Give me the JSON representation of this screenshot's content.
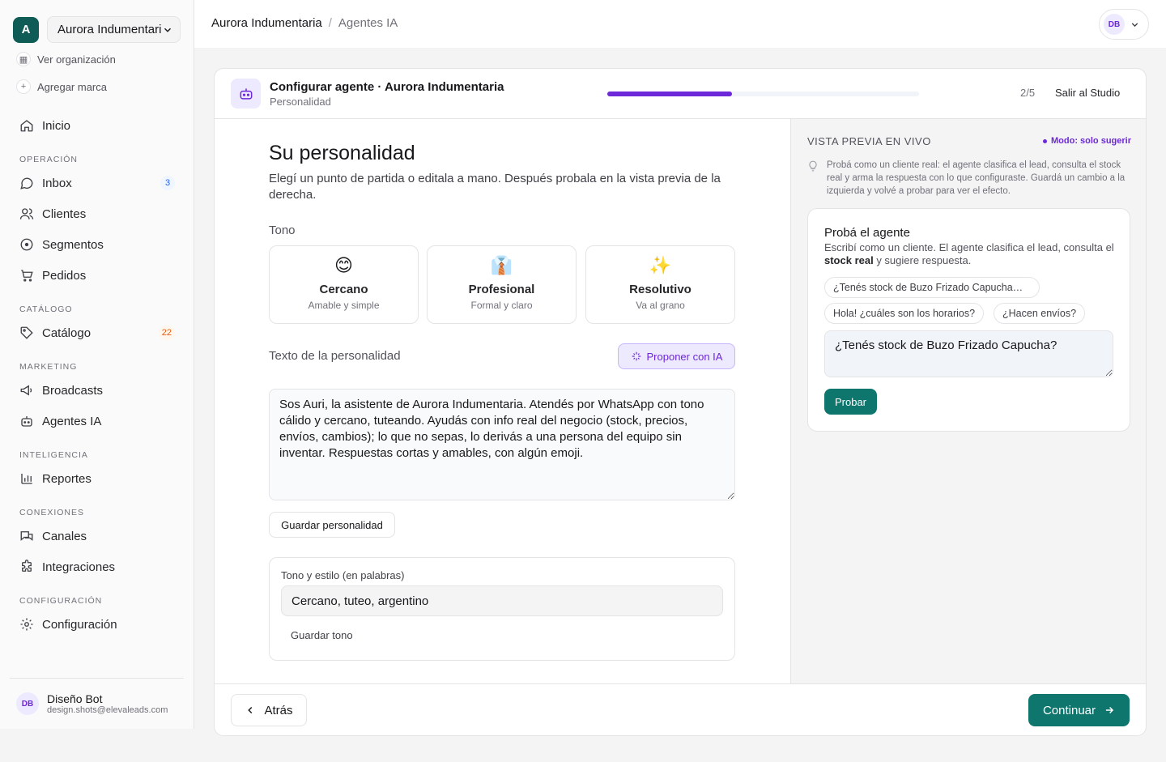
{
  "org": {
    "initial": "A",
    "selected": "Aurora Indumentaria",
    "view_org": "Ver organización",
    "add_brand": "Agregar marca"
  },
  "sidebar": {
    "home": "Inicio",
    "sections": {
      "operacion": "OPERACIÓN",
      "catalogo": "CATÁLOGO",
      "marketing": "MARKETING",
      "inteligencia": "INTELIGENCIA",
      "conexiones": "CONEXIONES",
      "configuracion": "CONFIGURACIÓN"
    },
    "items": {
      "inbox": "Inbox",
      "inbox_count": "3",
      "clientes": "Clientes",
      "segmentos": "Segmentos",
      "pedidos": "Pedidos",
      "catalogo": "Catálogo",
      "catalogo_count": "22",
      "broadcasts": "Broadcasts",
      "agentes": "Agentes IA",
      "reportes": "Reportes",
      "canales": "Canales",
      "integraciones": "Integraciones",
      "configuracion": "Configuración"
    },
    "user": {
      "initials": "DB",
      "name": "Diseño Bot",
      "email": "design.shots@elevaleads.com"
    }
  },
  "topbar": {
    "crumb1": "Aurora Indumentaria",
    "sep": "/",
    "crumb2": "Agentes IA",
    "user_initials": "DB"
  },
  "studio": {
    "title": "Configurar agente · Aurora Indumentaria",
    "step_name": "Personalidad",
    "progress": 0.4,
    "step_count": "2/5",
    "exit": "Salir al Studio"
  },
  "personality": {
    "heading": "Su personalidad",
    "intro": "Elegí un punto de partida o editala a mano. Después probala en la vista previa de la derecha.",
    "tone_label": "Tono",
    "tones": [
      {
        "emoji": "😊",
        "title": "Cercano",
        "subtitle": "Amable y simple"
      },
      {
        "emoji": "👔",
        "title": "Profesional",
        "subtitle": "Formal y claro"
      },
      {
        "emoji": "✨",
        "title": "Resolutivo",
        "subtitle": "Va al grano"
      }
    ],
    "text_label": "Texto de la personalidad",
    "propose_ai": "Proponer con IA",
    "text_value": "Sos Auri, la asistente de Aurora Indumentaria. Atendés por WhatsApp con tono cálido y cercano, tuteando. Ayudás con info real del negocio (stock, precios, envíos, cambios); lo que no sepas, lo derivás a una persona del equipo sin inventar. Respuestas cortas y amables, con algún emoji.",
    "save_personality": "Guardar personalidad",
    "style_label": "Tono y estilo (en palabras)",
    "style_value": "Cercano, tuteo, argentino",
    "save_tone": "Guardar tono"
  },
  "preview": {
    "title": "VISTA PREVIA EN VIVO",
    "mode": "Modo: solo sugerir",
    "hint": "Probá como un cliente real: el agente clasifica el lead, consulta el stock real y arma la respuesta con lo que configuraste. Guardá un cambio a la izquierda y volvé a probar para ver el efecto.",
    "card_title": "Probá el agente",
    "card_desc_1": "Escribí como un cliente. El agente clasifica el lead, consulta el ",
    "card_desc_bold": "stock real",
    "card_desc_2": " y sugiere respuesta.",
    "chips": [
      "¿Tenés stock de Buzo Frizado Capucha…",
      "Hola! ¿cuáles son los horarios?",
      "¿Hacen envíos?"
    ],
    "input_value": "¿Tenés stock de Buzo Frizado Capucha?",
    "test_button": "Probar"
  },
  "footer": {
    "back": "Atrás",
    "continue": "Continuar"
  },
  "colors": {
    "brand": "#0f766e",
    "accent": "#6d28d9"
  }
}
